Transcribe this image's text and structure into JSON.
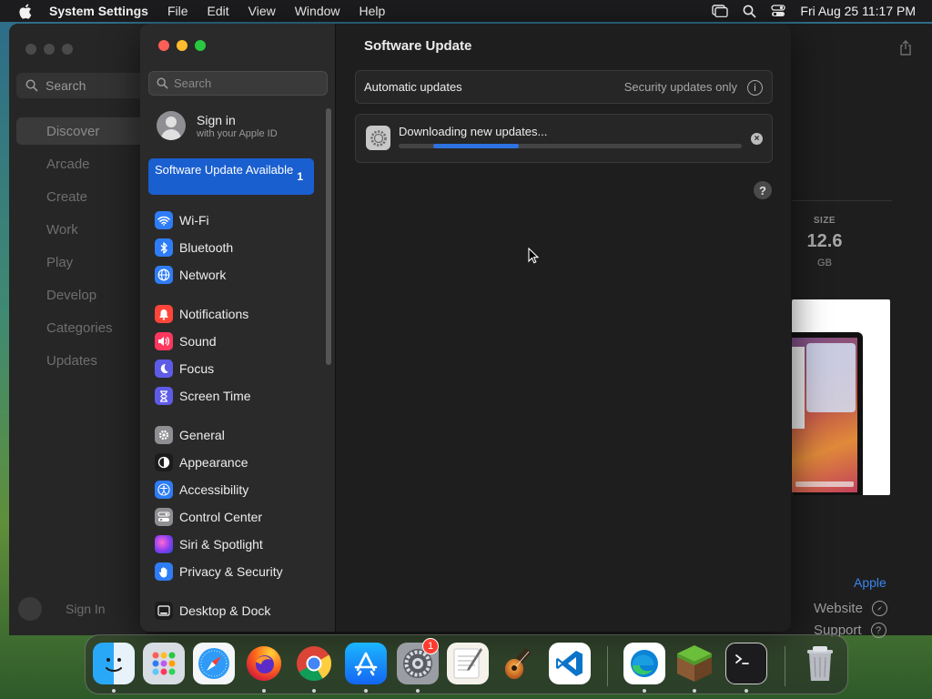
{
  "menubar": {
    "app_name": "System Settings",
    "menus": [
      "File",
      "Edit",
      "View",
      "Window",
      "Help"
    ],
    "clock": "Fri Aug 25  11:17 PM"
  },
  "appstore": {
    "search_placeholder": "Search",
    "nav": [
      "Discover",
      "Arcade",
      "Create",
      "Work",
      "Play",
      "Develop",
      "Categories",
      "Updates"
    ],
    "active_nav": "Discover",
    "sign_in": "Sign In",
    "size_label": "SIZE",
    "size_value": "12.6",
    "size_unit": "GB",
    "developer": "Apple",
    "website": "Website",
    "support": "Support"
  },
  "settings": {
    "search_placeholder": "Search",
    "user_title": "Sign in",
    "user_subtitle": "with your Apple ID",
    "update_label": "Software Update Available",
    "update_count": "1",
    "groups": [
      [
        {
          "label": "Wi-Fi",
          "icon": "wifi-icon",
          "color": "#2f7df6"
        },
        {
          "label": "Bluetooth",
          "icon": "bluetooth-icon",
          "color": "#2f7df6"
        },
        {
          "label": "Network",
          "icon": "network-icon",
          "color": "#2f7df6"
        }
      ],
      [
        {
          "label": "Notifications",
          "icon": "notifications-icon",
          "color": "#ff453a"
        },
        {
          "label": "Sound",
          "icon": "sound-icon",
          "color": "#ff375f"
        },
        {
          "label": "Focus",
          "icon": "focus-icon",
          "color": "#5e5ce6"
        },
        {
          "label": "Screen Time",
          "icon": "screen-time-icon",
          "color": "#5e5ce6"
        }
      ],
      [
        {
          "label": "General",
          "icon": "general-icon",
          "color": "#8e8e93"
        },
        {
          "label": "Appearance",
          "icon": "appearance-icon",
          "color": "#1c1c1e"
        },
        {
          "label": "Accessibility",
          "icon": "accessibility-icon",
          "color": "#2f7df6"
        },
        {
          "label": "Control Center",
          "icon": "control-center-icon",
          "color": "#8e8e93"
        },
        {
          "label": "Siri & Spotlight",
          "icon": "siri-icon",
          "color": "#bf5af2"
        },
        {
          "label": "Privacy & Security",
          "icon": "privacy-icon",
          "color": "#2f7df6"
        }
      ],
      [
        {
          "label": "Desktop & Dock",
          "icon": "desktop-dock-icon",
          "color": "#1c1c1e"
        }
      ]
    ],
    "page_title": "Software Update",
    "auto_updates_label": "Automatic updates",
    "auto_updates_value": "Security updates only",
    "download_message": "Downloading new updates...",
    "download_progress_start": 0.1,
    "download_progress_end": 0.35
  },
  "dock": {
    "apps": [
      "Finder",
      "Launchpad",
      "Safari",
      "Firefox",
      "Chrome",
      "App Store",
      "System Settings",
      "TextEdit",
      "GarageBand",
      "Visual Studio Code",
      "Microsoft Edge",
      "Minecraft",
      "Terminal",
      "Trash"
    ],
    "settings_badge": "1"
  },
  "colors": {
    "accent": "#1a5fd0",
    "progress": "#2d72e0",
    "close": "#ff5f57",
    "minimize": "#febc2e",
    "zoom": "#28c840"
  }
}
